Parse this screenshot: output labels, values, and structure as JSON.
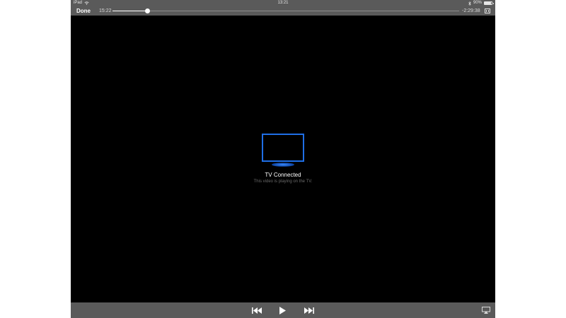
{
  "status_bar": {
    "device": "iPad",
    "time": "13:21",
    "battery": "90%",
    "battery_level": 0.9
  },
  "top_bar": {
    "done_label": "Done",
    "elapsed": "15:22",
    "remaining": "-2:29:38",
    "progress": 0.1
  },
  "center": {
    "title": "TV Connected",
    "subtitle": "This video is playing on the TV."
  },
  "controls": {
    "icons": [
      "rewind-icon",
      "play-icon",
      "fast-forward-icon",
      "airplay-icon"
    ]
  },
  "colors": {
    "tv_outline": "#1f6fe6",
    "bar_background": "#5a5a5a",
    "video_background": "#000000"
  }
}
